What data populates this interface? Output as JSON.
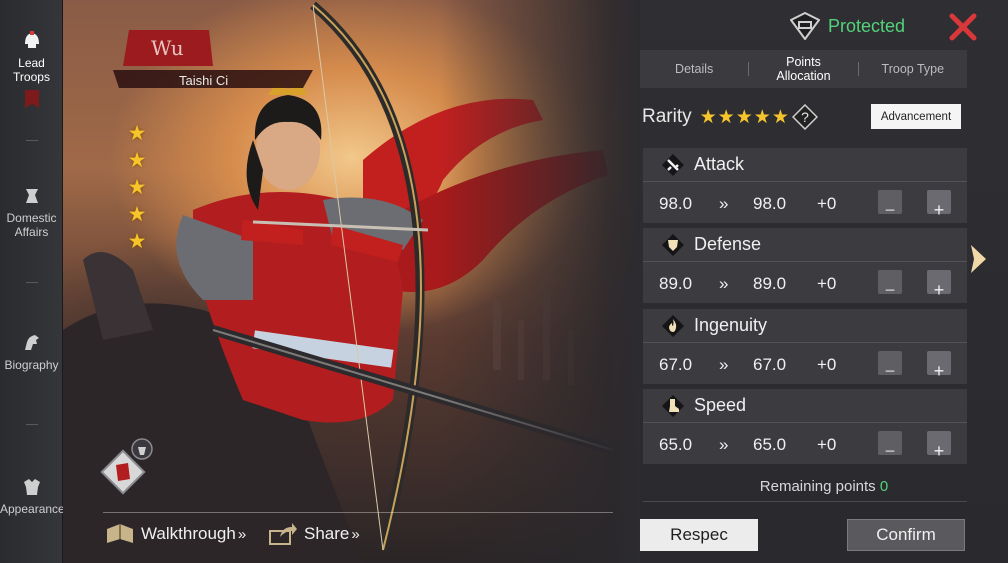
{
  "sidebar": {
    "items": [
      {
        "label_line1": "Lead",
        "label_line2": "Troops",
        "icon": "helmet-icon",
        "active": true
      },
      {
        "label_line1": "Domestic",
        "label_line2": "Affairs",
        "icon": "scroll-icon"
      },
      {
        "label_line1": "Biography",
        "label_line2": "",
        "icon": "horse-icon"
      },
      {
        "label_line1": "Appearance",
        "label_line2": "",
        "icon": "armor-icon"
      }
    ]
  },
  "hero": {
    "faction": "Wu",
    "name": "Taishi Ci",
    "stars": 5
  },
  "bottom_bar": {
    "walkthrough_label": "Walkthrough",
    "share_label": "Share",
    "chevron": "»"
  },
  "status": {
    "protected_label": "Protected",
    "accent_green": "#52d37a"
  },
  "tabs": [
    {
      "label": "Details"
    },
    {
      "label_line1": "Points",
      "label_line2": "Allocation",
      "active": true
    },
    {
      "label": "Troop Type"
    }
  ],
  "rarity": {
    "label": "Rarity",
    "stars": 5,
    "help": "?",
    "advancement_label": "Advancement"
  },
  "stats": [
    {
      "name": "Attack",
      "icon": "sword-icon",
      "current": "98.0",
      "arrow": "»",
      "new": "98.0",
      "added": "+0",
      "minus": "−",
      "plus": "+"
    },
    {
      "name": "Defense",
      "icon": "shield-icon",
      "current": "89.0",
      "arrow": "»",
      "new": "89.0",
      "added": "+0",
      "minus": "−",
      "plus": "+"
    },
    {
      "name": "Ingenuity",
      "icon": "flame-icon",
      "current": "67.0",
      "arrow": "»",
      "new": "67.0",
      "added": "+0",
      "minus": "−",
      "plus": "+"
    },
    {
      "name": "Speed",
      "icon": "boot-icon",
      "current": "65.0",
      "arrow": "»",
      "new": "65.0",
      "added": "+0",
      "minus": "−",
      "plus": "+"
    }
  ],
  "remaining": {
    "label": "Remaining points",
    "value": "0"
  },
  "actions": {
    "respec_label": "Respec",
    "confirm_label": "Confirm"
  },
  "colors": {
    "star": "#f6c52c",
    "close": "#d9383a",
    "faction_red": "#9b1b1f"
  }
}
